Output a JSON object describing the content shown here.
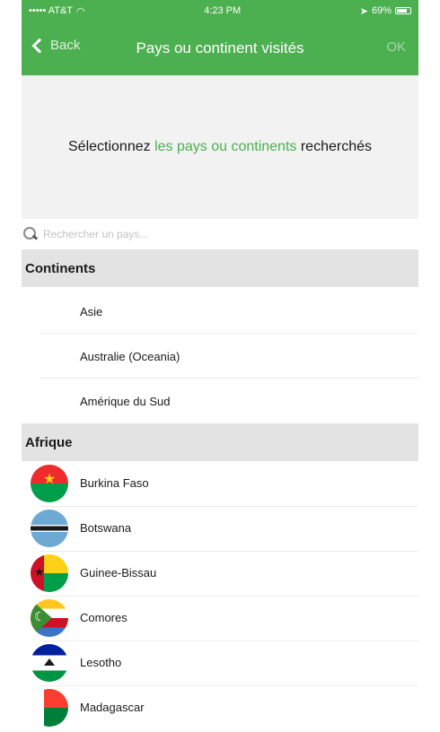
{
  "status_bar": {
    "carrier": "••••• AT&T",
    "time": "4:23 PM",
    "battery": "69%"
  },
  "nav": {
    "back_label": "Back",
    "title": "Pays ou continent visités",
    "ok_label": "OK"
  },
  "header": {
    "text_before": "Sélectionnez ",
    "text_accent": "les pays ou continents",
    "text_after": " recherchés"
  },
  "search": {
    "placeholder": "Rechercher un pays..."
  },
  "sections": {
    "continents": {
      "title": "Continents",
      "items": [
        {
          "label": "Asie"
        },
        {
          "label": "Australie (Oceania)"
        },
        {
          "label": "Amérique du Sud"
        }
      ]
    },
    "afrique": {
      "title": "Afrique",
      "items": [
        {
          "label": "Burkina Faso",
          "icon": "flag-burkina-faso-icon"
        },
        {
          "label": "Botswana",
          "icon": "flag-botswana-icon"
        },
        {
          "label": "Guinee-Bissau",
          "icon": "flag-guinea-bissau-icon"
        },
        {
          "label": "Comores",
          "icon": "flag-comoros-icon"
        },
        {
          "label": "Lesotho",
          "icon": "flag-lesotho-icon"
        },
        {
          "label": "Madagascar",
          "icon": "flag-madagascar-icon"
        }
      ]
    }
  },
  "colors": {
    "accent": "#4caf50",
    "section_bg": "#e3e3e3",
    "header_bg": "#f2f2f2"
  }
}
